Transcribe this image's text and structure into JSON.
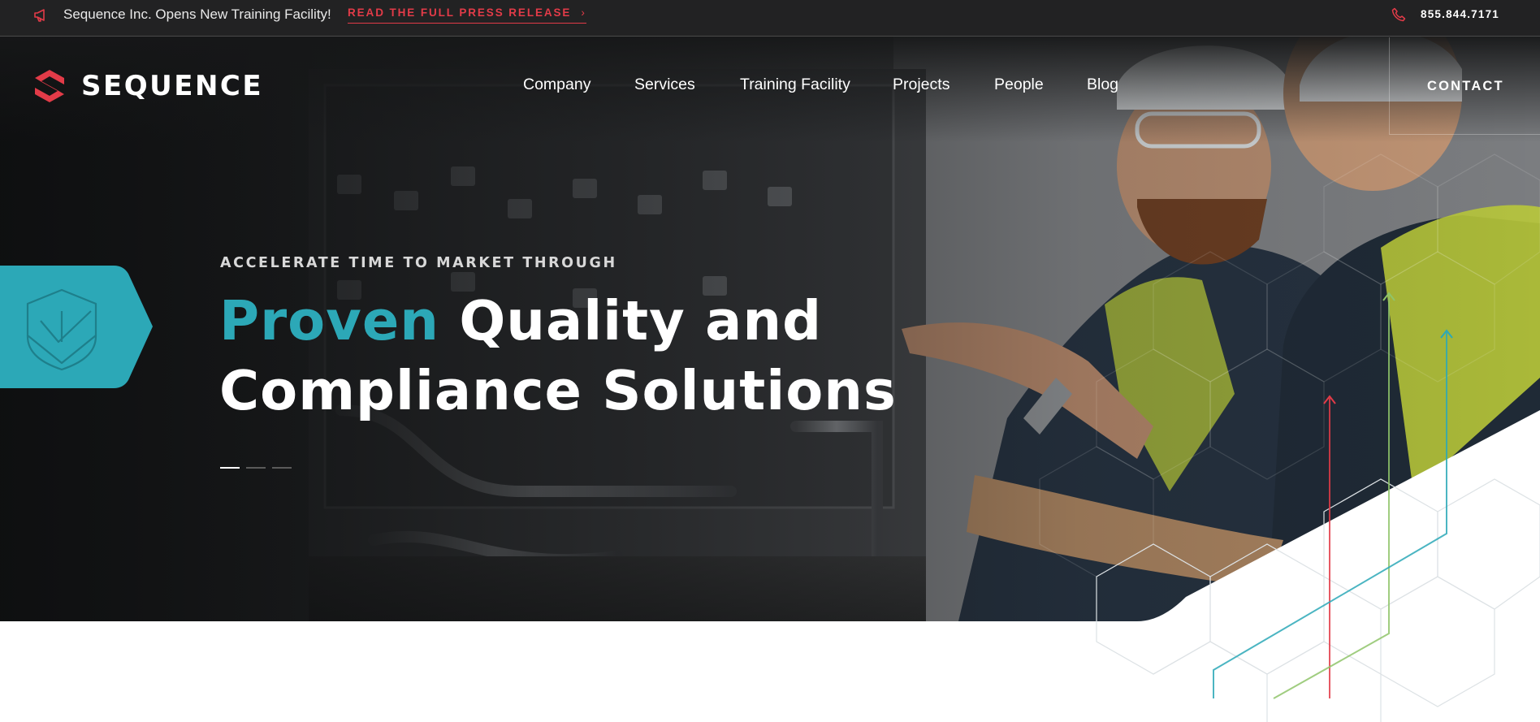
{
  "announcement": {
    "text": "Sequence Inc. Opens New Training Facility!",
    "link_label": "READ THE FULL PRESS RELEASE",
    "link_chevron": "›",
    "icon": "megaphone-icon"
  },
  "contact_bar": {
    "phone": "855.844.7171",
    "icon": "phone-icon"
  },
  "header": {
    "logo_text": "SEQUENCE",
    "nav": [
      "Company",
      "Services",
      "Training Facility",
      "Projects",
      "People",
      "Blog"
    ],
    "contact_label": "CONTACT"
  },
  "hero": {
    "eyebrow": "ACCELERATE TIME TO MARKET THROUGH",
    "headline_accent": "Proven",
    "headline_line1_rest": "Quality and",
    "headline_line2": "Compliance Solutions",
    "badge_icon": "shield-check-icon",
    "slides_total": 3,
    "slide_active": 1
  },
  "colors": {
    "brand_red": "#e23b48",
    "accent_teal": "#2ca8b7",
    "green_line": "#8fc46a",
    "dark_bg": "#222223"
  }
}
